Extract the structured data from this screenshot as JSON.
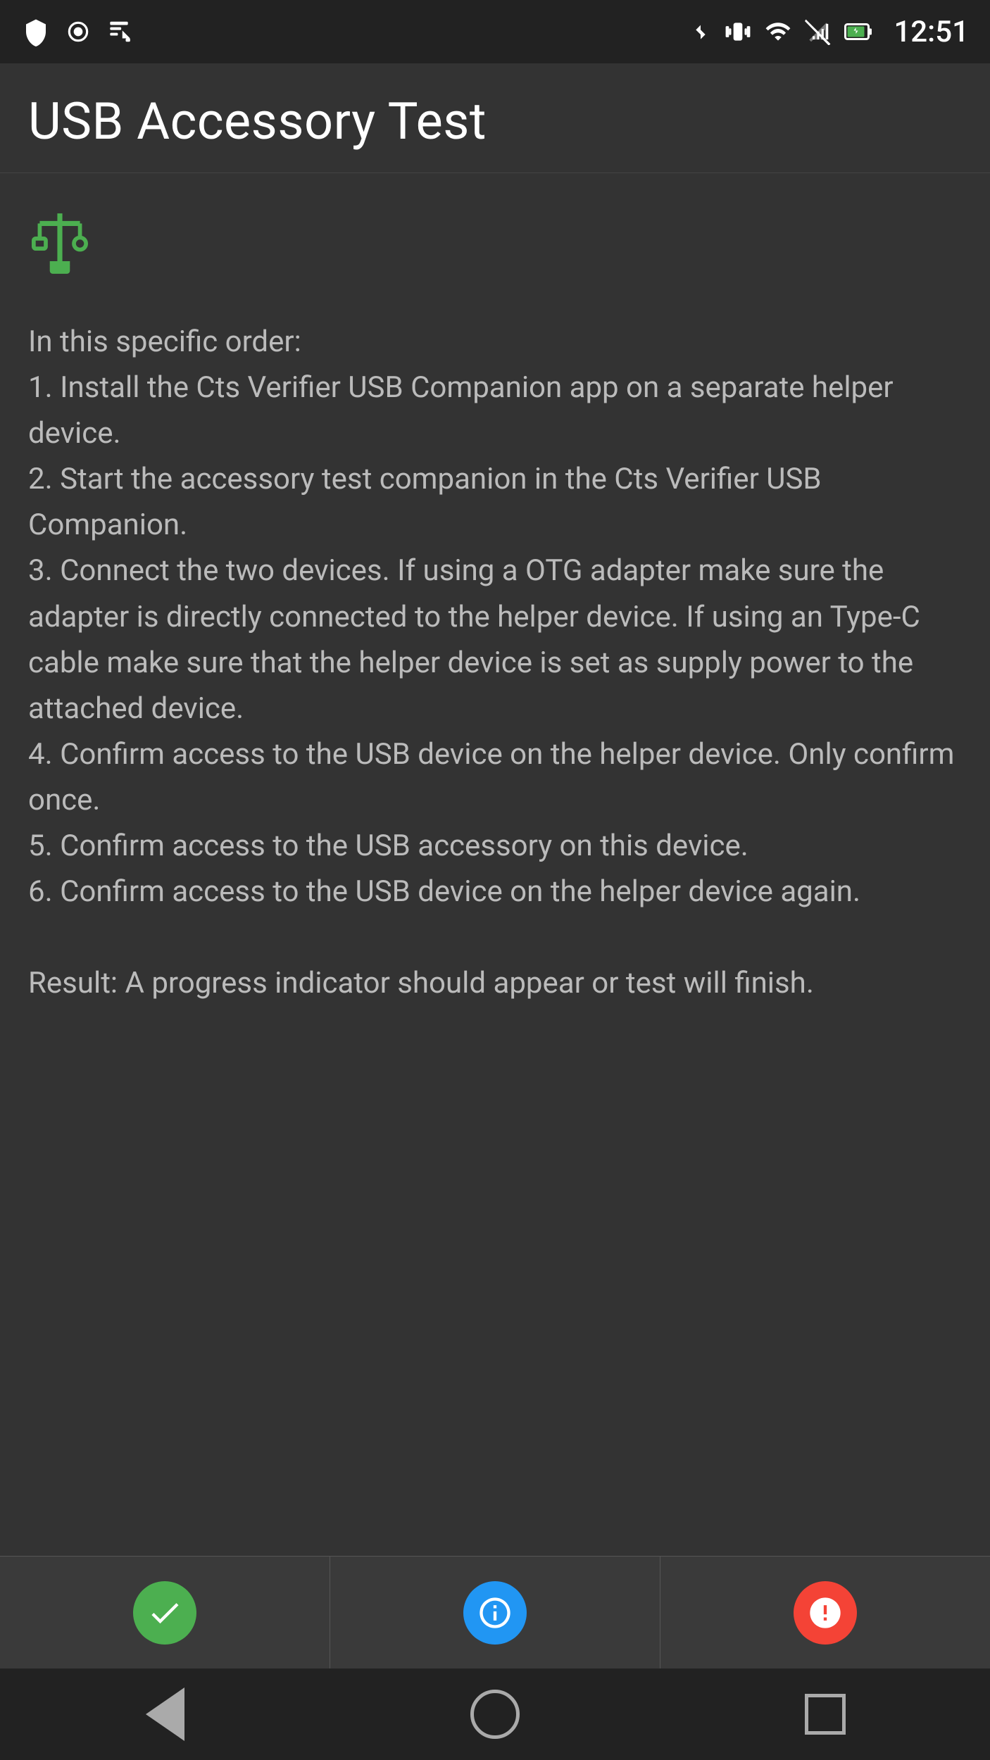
{
  "statusBar": {
    "time": "12:51",
    "icons": [
      "shield",
      "record",
      "download",
      "bluetooth",
      "vibrate",
      "wifi",
      "signal-off",
      "battery"
    ]
  },
  "appBar": {
    "title": "USB Accessory Test"
  },
  "content": {
    "usb_icon": "⌬",
    "intro": "In this specific order:",
    "steps": [
      "1. Install the Cts Verifier USB Companion app on a separate helper device.",
      "2. Start the accessory test companion in the Cts Verifier USB Companion.",
      "3. Connect the two devices. If using a OTG adapter make sure the adapter is directly connected to the helper device. If using an Type-C cable make sure that the helper device is set as supply power to the attached device.",
      "4. Confirm access to the USB device on the helper device. Only confirm once.",
      "5. Confirm access to the USB accessory on this device.",
      "6. Confirm access to the USB device on the helper device again."
    ],
    "result": "Result: A progress indicator should appear or test will finish."
  },
  "bottomBar": {
    "pass_label": "✓",
    "info_label": "?",
    "fail_label": "!"
  },
  "navBar": {
    "back_label": "◀",
    "home_label": "○",
    "recents_label": "□"
  }
}
